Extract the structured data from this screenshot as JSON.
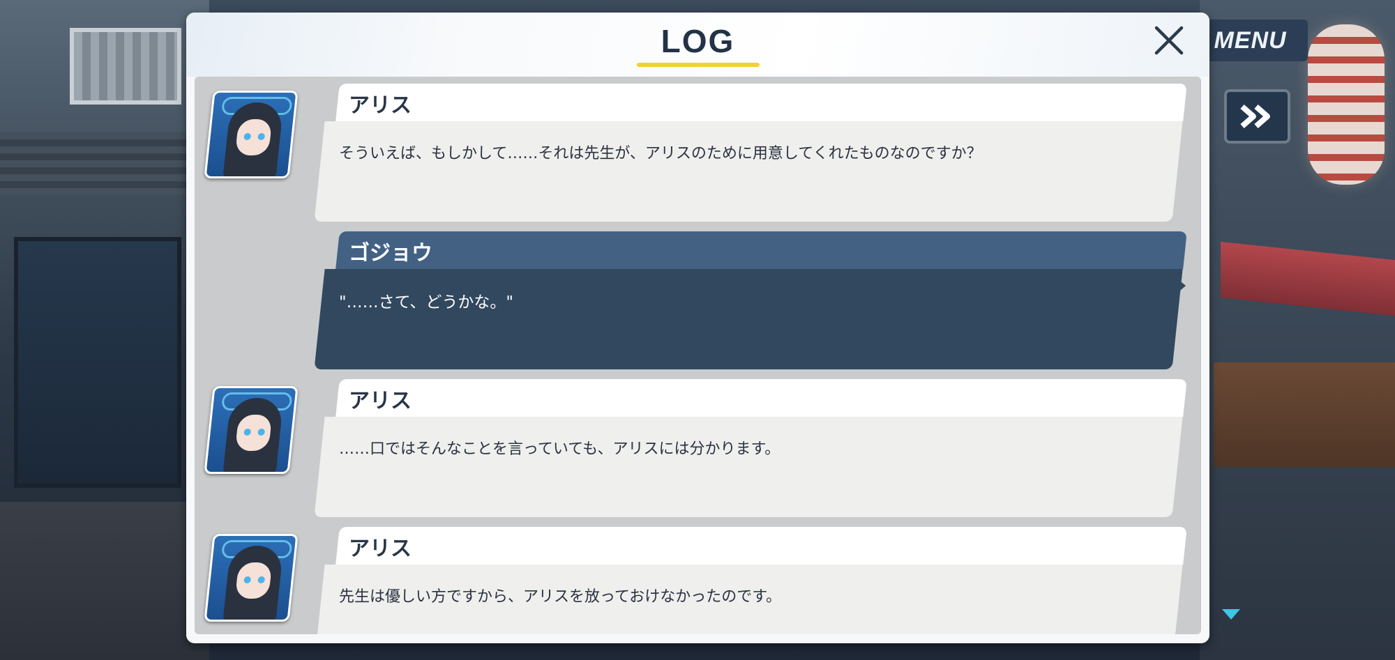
{
  "hud": {
    "menu_label": "MENU",
    "fast_forward_icon": "fast-forward-icon",
    "scroll_down_icon": "triangle-down-icon"
  },
  "log": {
    "title": "LOG",
    "close_icon": "close-icon",
    "entries": [
      {
        "speaker": "アリス",
        "text": "そういえば、もしかして……それは先生が、アリスのために用意してくれたものなのですか？",
        "avatar": "alice-portrait"
      },
      {
        "speaker": "ゴジョウ",
        "text": "\"……さて、どうかな。\"",
        "avatar": ""
      },
      {
        "speaker": "アリス",
        "text": "……口ではそんなことを言っていても、アリスには分かります。",
        "avatar": "alice-portrait"
      },
      {
        "speaker": "アリス",
        "text": "先生は優しい方ですから、アリスを放っておけなかったのです。",
        "avatar": "alice-portrait"
      }
    ]
  },
  "colors": {
    "accent_underline": "#f2d22e",
    "player_bubble": "#32485f",
    "player_name_bar": "#436183",
    "npc_bubble": "#efefed",
    "scroll_arrow": "#3ec5e8"
  }
}
